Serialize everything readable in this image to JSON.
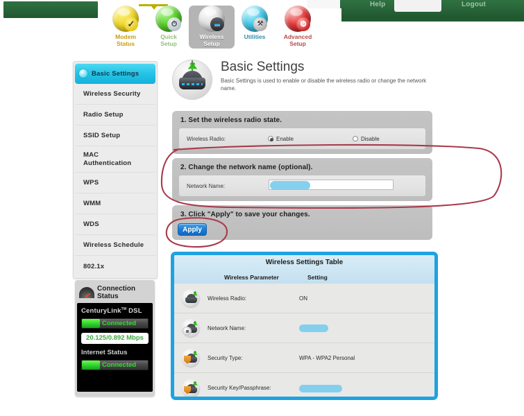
{
  "topbar": {
    "help_label": "Help",
    "logout_label": "Logout",
    "bar_color": "#276237"
  },
  "topnav": {
    "items": [
      {
        "label_line1": "Modem",
        "label_line2": "Status",
        "icon": "check-orb-icon",
        "color": "#f2da2a",
        "active": false
      },
      {
        "label_line1": "Quick",
        "label_line2": "Setup",
        "icon": "clock-orb-icon",
        "color": "#5ad22c",
        "active": false
      },
      {
        "label_line1": "Wireless",
        "label_line2": "Setup",
        "icon": "router-orb-icon",
        "color": "#d0d0d0",
        "active": true
      },
      {
        "label_line1": "Utilities",
        "label_line2": "",
        "icon": "tools-orb-icon",
        "color": "#44c8e8",
        "active": false
      },
      {
        "label_line1": "Advanced",
        "label_line2": "Setup",
        "icon": "gears-orb-icon",
        "color": "#e33a3a",
        "active": false
      }
    ]
  },
  "sidebar": {
    "items": [
      {
        "label": "Basic Settings",
        "selected": true
      },
      {
        "label": "Wireless Security",
        "selected": false
      },
      {
        "label": "Radio Setup",
        "selected": false
      },
      {
        "label": "SSID Setup",
        "selected": false
      },
      {
        "label": "MAC\nAuthentication",
        "selected": false
      },
      {
        "label": "WPS",
        "selected": false
      },
      {
        "label": "WMM",
        "selected": false
      },
      {
        "label": "WDS",
        "selected": false
      },
      {
        "label": "Wireless Schedule",
        "selected": false
      },
      {
        "label": "802.1x",
        "selected": false
      }
    ]
  },
  "connection_status": {
    "heading_line1": "Connection",
    "heading_line2": "Status",
    "brand": "CenturyLink",
    "brand_sup": "TM",
    "brand_suffix": "DSL",
    "dsl_status": "Connected",
    "speed": "20.125/0.892 Mbps",
    "internet_label": "Internet Status",
    "internet_status": "Connected",
    "connected_color": "#2fd02f"
  },
  "page": {
    "title": "Basic Settings",
    "description": "Basic Settings is used to enable or disable the wireless radio or change the network name."
  },
  "step1": {
    "title": "1. Set the wireless radio state.",
    "field_label": "Wireless Radio:",
    "option_enable": "Enable",
    "option_disable": "Disable",
    "selected": "Enable"
  },
  "step2": {
    "title": "2. Change the network name (optional).",
    "field_label": "Network Name:",
    "value": "",
    "redacted": true
  },
  "step3": {
    "title": "3. Click \"Apply\" to save your changes.",
    "apply_label": "Apply"
  },
  "wireless_table": {
    "title": "Wireless Settings Table",
    "col_parameter": "Wireless Parameter",
    "col_setting": "Setting",
    "rows": [
      {
        "icon": "router-antenna-icon",
        "parameter": "Wireless Radio:",
        "setting": "ON",
        "redacted": false
      },
      {
        "icon": "router-lock-icon",
        "parameter": "Network Name:",
        "setting": "",
        "redacted": true
      },
      {
        "icon": "router-shield-icon",
        "parameter": "Security Type:",
        "setting": "WPA - WPA2 Personal",
        "redacted": false
      },
      {
        "icon": "router-shield-icon",
        "parameter": "Security Key/Passphrase:",
        "setting": "",
        "redacted": true
      }
    ],
    "border_color": "#1ea2e0"
  },
  "annotations": {
    "color": "#a83a4a",
    "shapes": [
      {
        "name": "network-name-highlight-ellipse"
      },
      {
        "name": "apply-button-highlight-ellipse"
      }
    ]
  }
}
